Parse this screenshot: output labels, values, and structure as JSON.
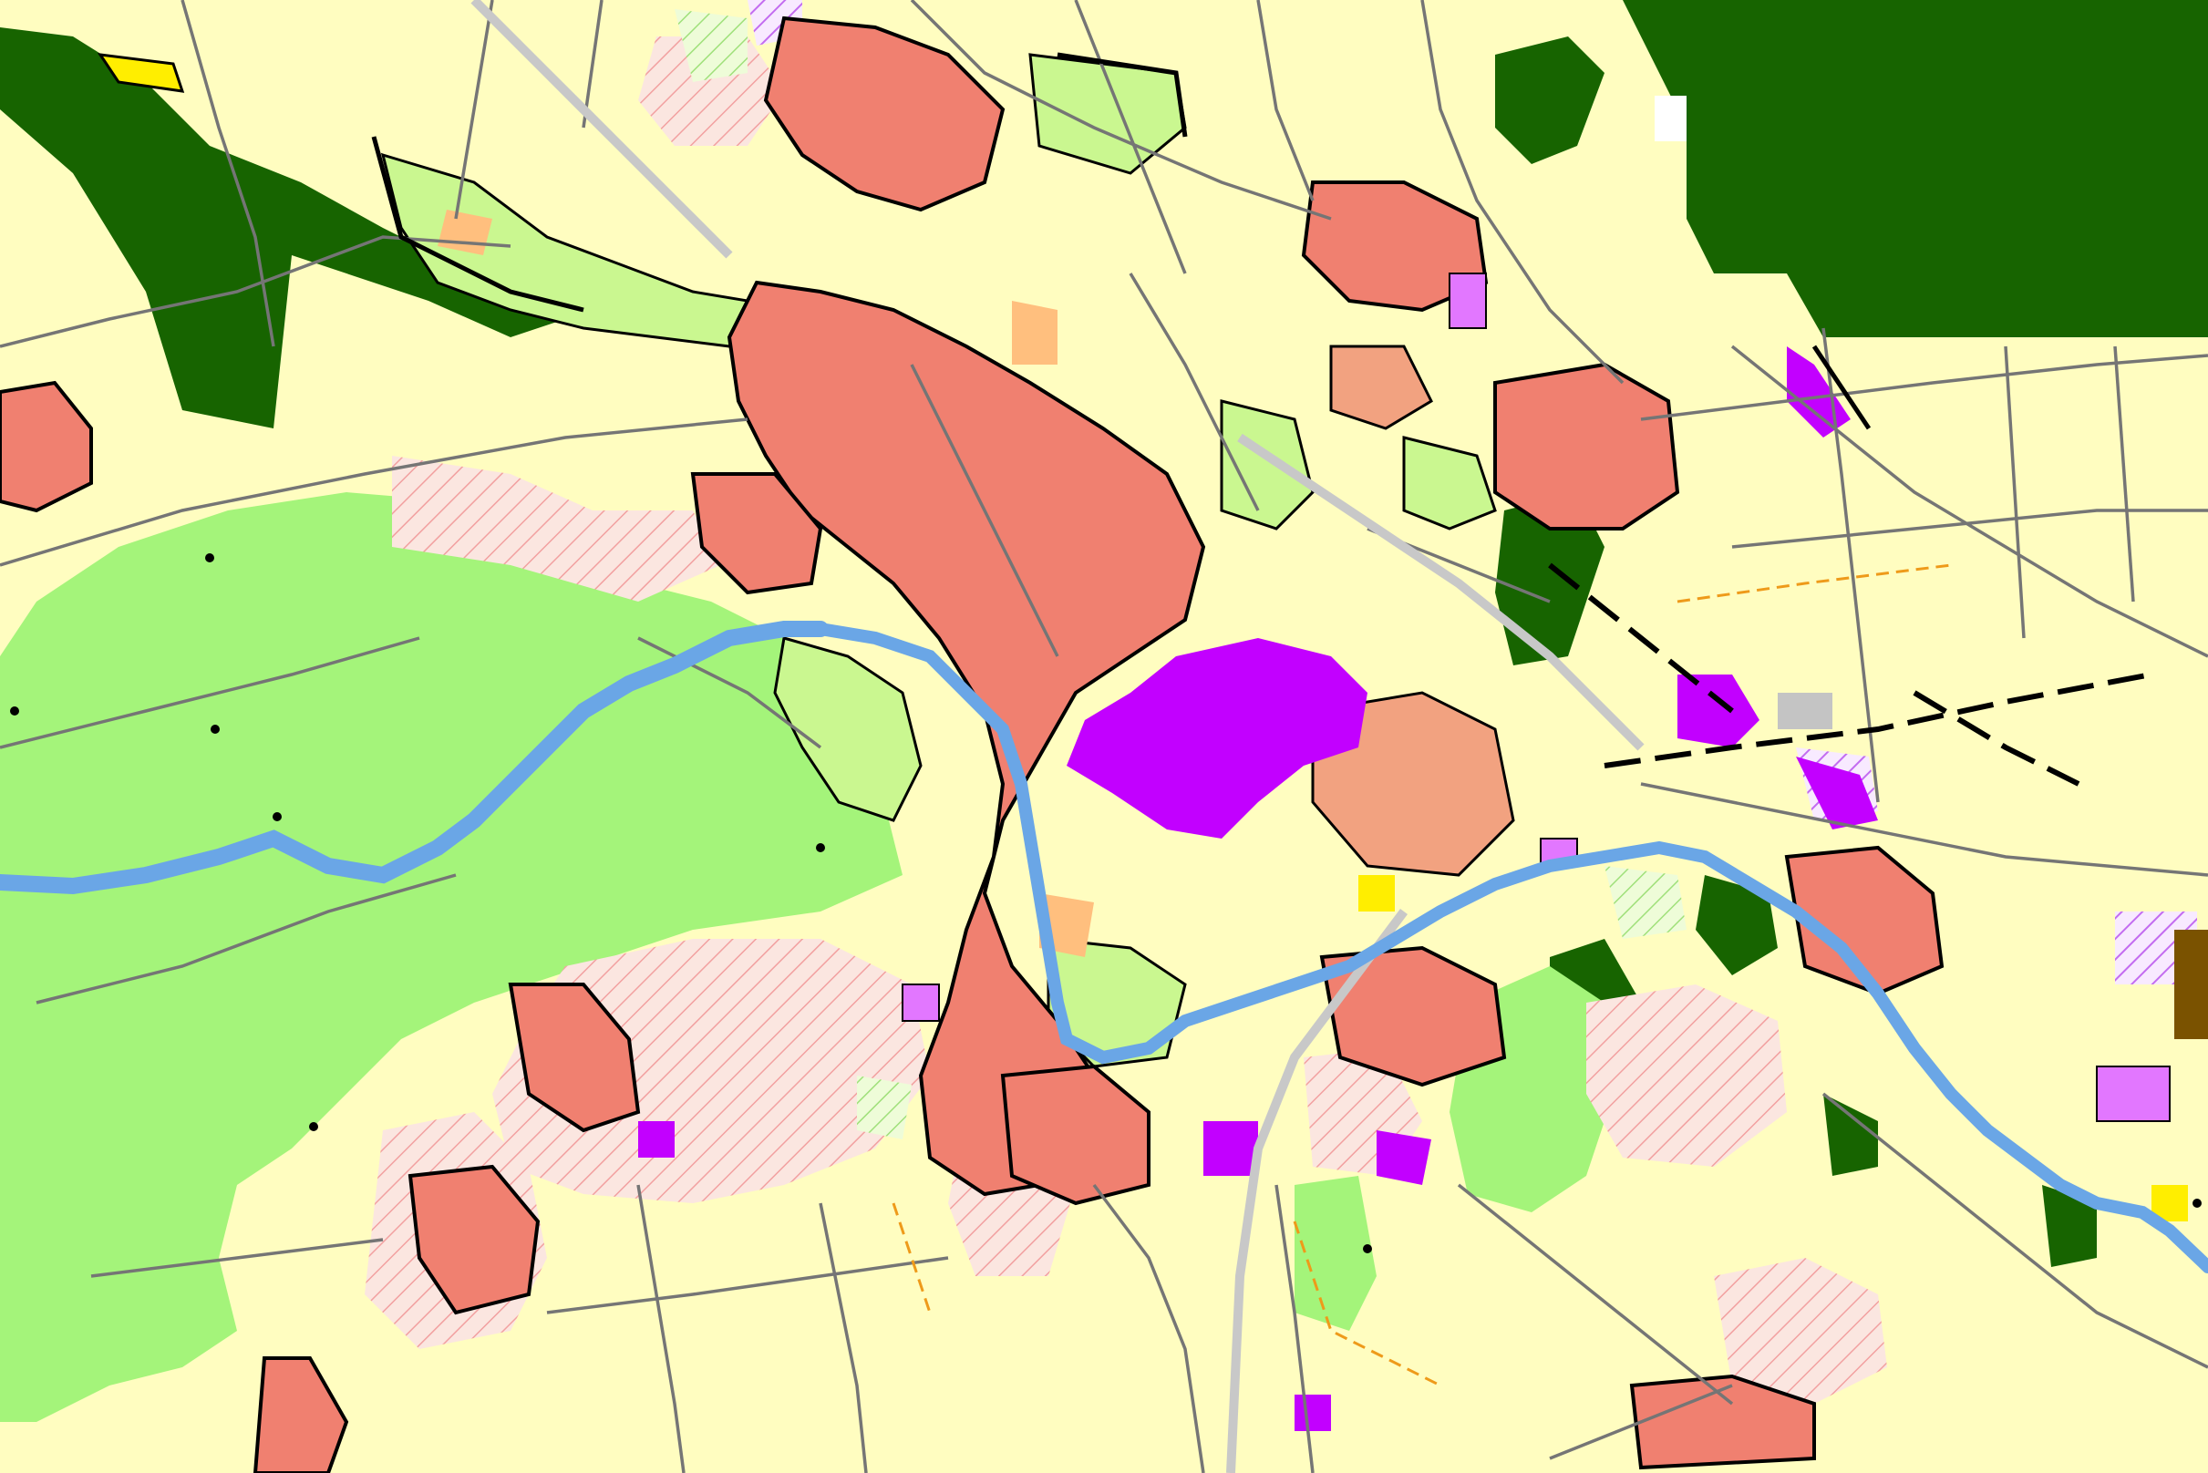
{
  "map": {
    "style": "land-use zoning plan (Flächennutzungsplan), no visible text labels",
    "colors": {
      "agriculture": "#fffdc0",
      "green_space": "#a4f47a",
      "light_green": "#caf790",
      "forest": "#176400",
      "residential": "#f08070",
      "mixed_use": "#f2a280",
      "commercial": "#ffbf7e",
      "industrial": "#c200ff",
      "special_area": "#e277ff",
      "planned_residential_hatch": "#f4a8a8",
      "river": "#6aa6e6",
      "roads": "#757575",
      "railway": "#c8c8c8",
      "boundary": "#000000",
      "planned_boundary": "#ee9a1a",
      "highlight_yellow": "#ffee00",
      "brown_area": "#7a5200",
      "gray_area": "#c4c4c4"
    },
    "layers": [
      "forest",
      "green-space",
      "residential",
      "industrial",
      "river",
      "roads",
      "railway",
      "boundaries"
    ]
  }
}
